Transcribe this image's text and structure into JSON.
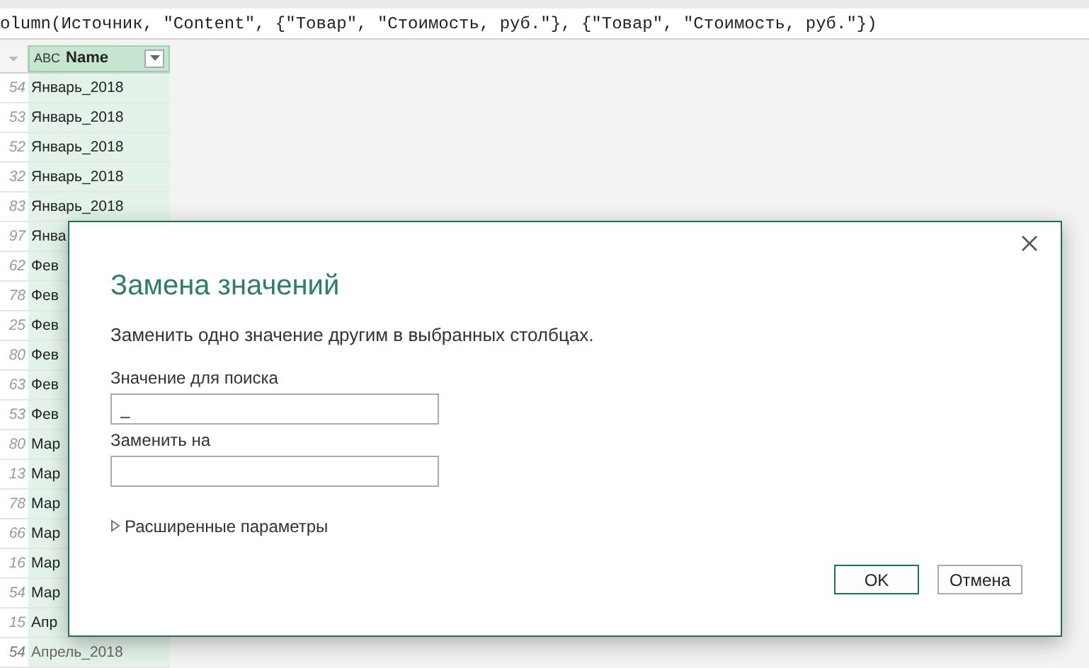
{
  "formula_bar": {
    "text": "olumn(Источник, \"Content\", {\"Товар\", \"Стоимость, руб.\"}, {\"Товар\", \"Стоимость, руб.\"})"
  },
  "table": {
    "columns": [
      {
        "name": "Name",
        "type_icon": "ABC"
      }
    ],
    "rows": [
      {
        "index": "54",
        "name": "Январь_2018"
      },
      {
        "index": "53",
        "name": "Январь_2018"
      },
      {
        "index": "52",
        "name": "Январь_2018"
      },
      {
        "index": "32",
        "name": "Январь_2018"
      },
      {
        "index": "83",
        "name": "Январь_2018"
      },
      {
        "index": "97",
        "name": "Янва"
      },
      {
        "index": "62",
        "name": "Фев"
      },
      {
        "index": "78",
        "name": "Фев"
      },
      {
        "index": "25",
        "name": "Фев"
      },
      {
        "index": "80",
        "name": "Фев"
      },
      {
        "index": "63",
        "name": "Фев"
      },
      {
        "index": "53",
        "name": "Фев"
      },
      {
        "index": "80",
        "name": "Мар"
      },
      {
        "index": "13",
        "name": "Мар"
      },
      {
        "index": "78",
        "name": "Мар"
      },
      {
        "index": "66",
        "name": "Мар"
      },
      {
        "index": "16",
        "name": "Мар"
      },
      {
        "index": "54",
        "name": "Мар"
      },
      {
        "index": "15",
        "name": "Апр"
      },
      {
        "index": "54",
        "name": "Апрель_2018"
      }
    ]
  },
  "dialog": {
    "title": "Замена значений",
    "description": "Заменить одно значение другим в выбранных столбцах.",
    "fields": [
      {
        "label": "Значение для поиска",
        "value": "_"
      },
      {
        "label": "Заменить на"
      }
    ],
    "advanced": {
      "label": "Расширенные параметры",
      "expanded": false
    },
    "buttons": [
      {
        "label": "OK",
        "primary": true
      },
      {
        "label": "Отмена",
        "primary": false
      }
    ]
  }
}
